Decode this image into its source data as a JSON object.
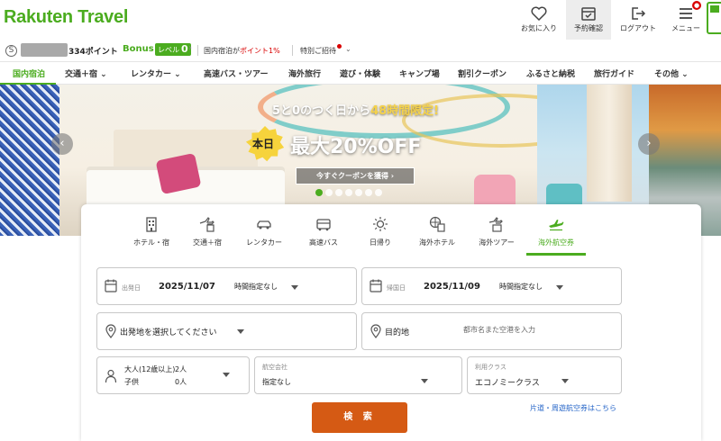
{
  "header": {
    "logo": "Rakuten Travel",
    "buttons": [
      {
        "label": "お気に入り",
        "icon": "heart-icon"
      },
      {
        "label": "予約確認",
        "icon": "calendar-check-icon",
        "active": true
      },
      {
        "label": "ログアウト",
        "icon": "logout-icon"
      },
      {
        "label": "メニュー",
        "icon": "menu-icon",
        "badge": "●"
      }
    ]
  },
  "points": {
    "coin": "S",
    "value": "334ポイント",
    "bonus": "Bonus",
    "level_label": "レベル",
    "level_value": "0",
    "domestic_prefix": "国内宿泊が",
    "domestic_highlight": "ポイント1%",
    "invite": "特別ご招待"
  },
  "nav": {
    "items": [
      "国内宿泊",
      "交通＋宿",
      "レンタカー",
      "高速バス・ツアー",
      "海外旅行",
      "遊び・体験",
      "キャンプ場",
      "割引クーポン",
      "ふるさと納税",
      "旅行ガイド",
      "その他"
    ]
  },
  "banner": {
    "headline_prefix": "5と0のつく日から",
    "headline_highlight": "48時間限定!",
    "badge": "本日",
    "big": "最大20%OFF",
    "cta": "今すぐクーポンを獲得",
    "cta_chevron": "›",
    "prev": "‹",
    "next": "›",
    "slides": 7,
    "active_slide": 0
  },
  "tabs": [
    {
      "label": "ホテル・宿",
      "icon": "hotel-icon"
    },
    {
      "label": "交通＋宿",
      "icon": "transit-hotel-icon"
    },
    {
      "label": "レンタカー",
      "icon": "car-icon"
    },
    {
      "label": "高速バス",
      "icon": "bus-icon"
    },
    {
      "label": "日帰り",
      "icon": "sun-icon"
    },
    {
      "label": "海外ホテル",
      "icon": "globe-hotel-icon"
    },
    {
      "label": "海外ツアー",
      "icon": "overseas-tour-icon"
    },
    {
      "label": "海外航空券",
      "icon": "airplane-icon",
      "active": true
    }
  ],
  "form": {
    "depart": {
      "label": "出発日",
      "date": "2025/11/07",
      "time": "時間指定なし"
    },
    "return": {
      "label": "帰国日",
      "date": "2025/11/09",
      "time": "時間指定なし"
    },
    "origin": {
      "text": "出発地を選択してください"
    },
    "destination": {
      "label": "目的地",
      "placeholder": "都市名また空港を入力"
    },
    "passengers": {
      "adult_label": "大人(12歳以上)",
      "adult_value": "2人",
      "child_label": "子供",
      "child_value": "0人"
    },
    "airline": {
      "label": "航空会社",
      "value": "指定なし"
    },
    "class": {
      "label": "利用クラス",
      "value": "エコノミークラス"
    },
    "search_button": "検 索",
    "oneway_link": "片道・周遊航空券はこちら"
  },
  "colors": {
    "brand": "#4bac1f",
    "cta": "#d55a14",
    "link": "#2a68c9",
    "alert": "#d90000"
  }
}
